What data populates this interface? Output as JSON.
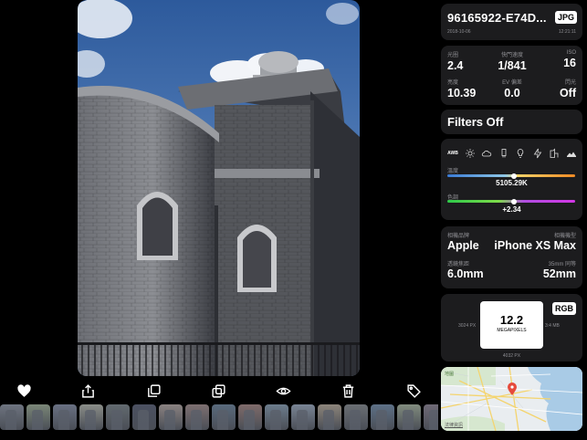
{
  "toolbar": {
    "buttons": [
      {
        "name": "favorite-heart-icon"
      },
      {
        "name": "share-icon"
      },
      {
        "name": "duplicate-icon"
      },
      {
        "name": "copy-icon"
      },
      {
        "name": "visibility-eye-icon"
      },
      {
        "name": "trash-icon"
      },
      {
        "name": "tag-icon"
      }
    ]
  },
  "filmstrip": {
    "colors": [
      "#6e7480",
      "#7a8677",
      "#697082",
      "#8a8d88",
      "#626a6f",
      "#4b5061",
      "#8a8281",
      "#7d6f70",
      "#596a7c",
      "#7f6b6a",
      "#6c7c8c",
      "#798494",
      "#8c847a",
      "#6a6e73",
      "#5e7187",
      "#818b7e",
      "#6f6a76",
      "#5d6677",
      "#8a7f74"
    ]
  },
  "title_card": {
    "filename": "96165922-E74D...",
    "format_badge": "JPG",
    "date": "2018-10-06",
    "time": "12:21:11"
  },
  "exif": {
    "aperture_label": "光圈",
    "aperture": "2.4",
    "shutter_label": "快門速度",
    "shutter": "1/841",
    "iso_label": "ISO",
    "iso": "16",
    "brightness_label": "亮度",
    "brightness": "10.39",
    "ev_label": "EV 偏差",
    "ev": "0.0",
    "flash_label": "閃光",
    "flash": "Off"
  },
  "filter": {
    "label": "Filters Off"
  },
  "white_balance": {
    "awb": "AWB",
    "icons": [
      "sun-icon",
      "cloud-icon",
      "tungsten-icon",
      "bulb-icon",
      "flash-bolt-icon",
      "shade-icon",
      "custom-wb-icon"
    ],
    "temp_label": "溫度",
    "temp_value": "5105.29K",
    "temp_fraction": 0.52,
    "tint_label": "色調",
    "tint_value": "+2.34",
    "tint_fraction": 0.52
  },
  "lens": {
    "make_label": "相機品牌",
    "make": "Apple",
    "model_label": "相機機型",
    "model": "iPhone XS Max",
    "focal_label": "透鏡焦距",
    "focal": "6.0mm",
    "equiv_label": "35mm 同等",
    "equiv": "52mm"
  },
  "resolution": {
    "megapixels": "12.2",
    "unit": "MEGAPIXELS",
    "format_badge": "RGB",
    "height_px": "3024 PX",
    "ratio": "3:4 MB",
    "width_px": "4032 PX"
  },
  "map": {
    "legal": "法律資訊",
    "brand": "地圖"
  },
  "colors": {
    "panel": "#1c1c1e",
    "pin": "#e64a3c",
    "sky": "#5a86c4"
  }
}
